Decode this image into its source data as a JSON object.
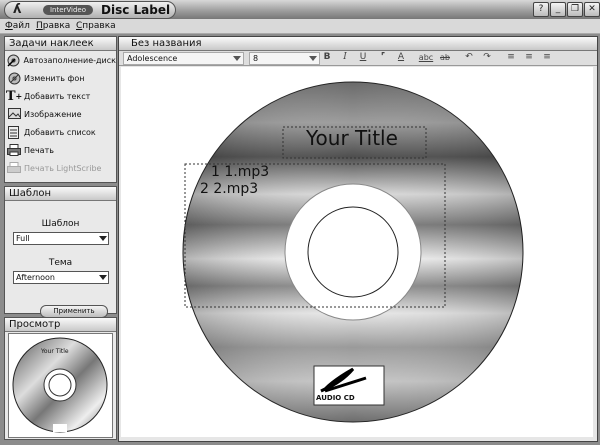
{
  "app": {
    "brand": "InterVideo",
    "title": "Disc Label"
  },
  "window_buttons": [
    "?",
    "_",
    "❐",
    "✕"
  ],
  "menu": [
    {
      "label": "Файл",
      "u": "Ф",
      "rest": "айл"
    },
    {
      "label": "Правка",
      "u": "П",
      "rest": "равка"
    },
    {
      "label": "Справка",
      "u": "С",
      "rest": "правка"
    }
  ],
  "tasks": {
    "title": "Задачи наклеек",
    "items": [
      {
        "label": "Автозаполнение-диск",
        "icon": "disc-wand-icon"
      },
      {
        "label": "Изменить фон",
        "icon": "background-disc-icon"
      },
      {
        "label": "Добавить текст",
        "icon": "text-plus-icon"
      },
      {
        "label": "Изображение",
        "icon": "image-icon"
      },
      {
        "label": "Добавить список",
        "icon": "list-icon"
      },
      {
        "label": "Печать",
        "icon": "printer-icon"
      },
      {
        "label": "Печать LightScribe",
        "icon": "lightscribe-printer-icon"
      }
    ]
  },
  "template": {
    "title": "Шаблон",
    "template_label": "Шаблон",
    "template_value": "Full",
    "theme_label": "Тема",
    "theme_value": "Afternoon",
    "apply": "Применить"
  },
  "preview": {
    "title": "Просмотр",
    "mini_title": "Your Title"
  },
  "document": {
    "title": "Без названия",
    "font": "Adolescence",
    "size": "8",
    "toolbar_icons": [
      "B",
      "I",
      "U",
      "⌜",
      "A",
      "abc",
      "ab",
      "↶",
      "↷",
      "≡",
      "≡",
      "≡"
    ]
  },
  "label": {
    "title": "Your Title",
    "tracks": [
      "1 1.mp3",
      "2 2.mp3"
    ],
    "logo_text": "AUDIO CD"
  }
}
